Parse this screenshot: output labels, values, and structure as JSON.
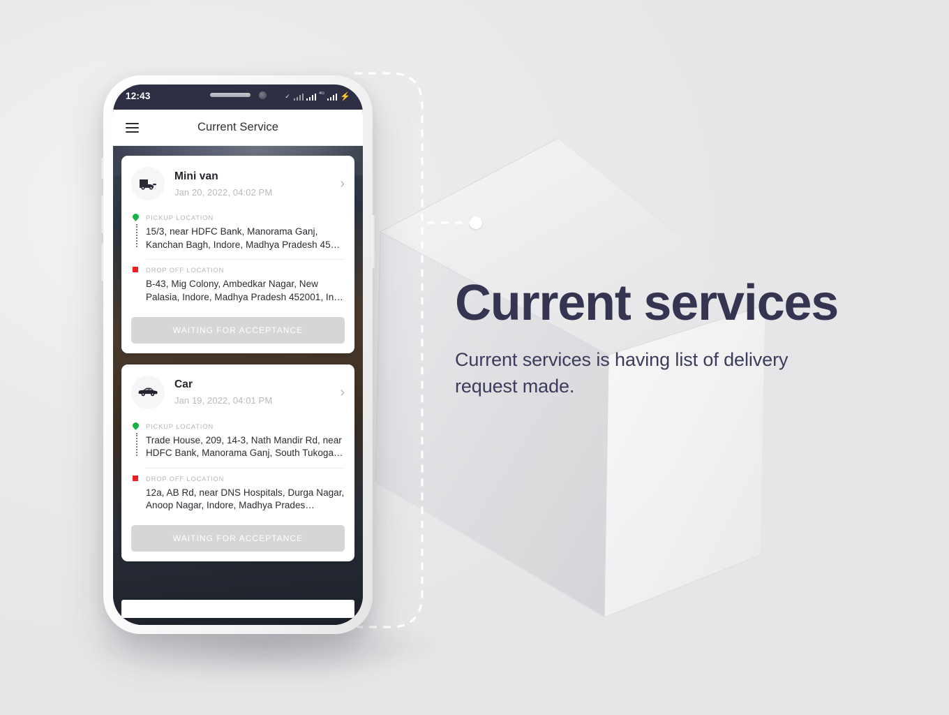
{
  "page": {
    "headline": "Current services",
    "subcopy": "Current services is having list of delivery request made."
  },
  "phone": {
    "statusbar": {
      "time": "12:43",
      "check_icon": "check-icon",
      "signal_icon": "signal-bars-icon",
      "network_label": "4G",
      "battery_icon": "battery-charging-icon"
    },
    "appbar": {
      "menu_icon": "hamburger-menu-icon",
      "title": "Current Service"
    },
    "home_indicator": "home-indicator"
  },
  "labels": {
    "pickup": "PICKUP LOCATION",
    "dropoff": "DROP OFF LOCATION",
    "pickup_marker_icon": "map-pin-icon",
    "dropoff_marker_icon": "square-marker-icon",
    "chevron_icon": "chevron-right-icon"
  },
  "services": [
    {
      "vehicle": "Mini van",
      "vehicle_icon": "van-icon",
      "datetime": "Jan 20, 2022, 04:02 PM",
      "pickup": "15/3, near HDFC Bank, Manorama Ganj, Kanchan Bagh, Indore, Madhya Pradesh 45…",
      "dropoff": "B-43, Mig Colony, Ambedkar Nagar, New Palasia, Indore, Madhya Pradesh 452001, In…",
      "status": "WAITING FOR ACCEPTANCE"
    },
    {
      "vehicle": "Car",
      "vehicle_icon": "car-icon",
      "datetime": "Jan 19, 2022, 04:01 PM",
      "pickup": "Trade House, 209, 14-3, Nath Mandir Rd, near HDFC Bank, Manorama Ganj, South Tukoga…",
      "dropoff": "12a, AB Rd, near DNS Hospitals, Durga Nagar, Anoop Nagar, Indore, Madhya Prades…",
      "status": "WAITING FOR ACCEPTANCE"
    }
  ],
  "colors": {
    "headline": "#353552",
    "pickup_marker": "#15b24a",
    "dropoff_marker": "#ef1f1f",
    "statusbar": "#2e2e44",
    "cta": "#d6d6d6",
    "battery_accent": "#2f6bff"
  }
}
